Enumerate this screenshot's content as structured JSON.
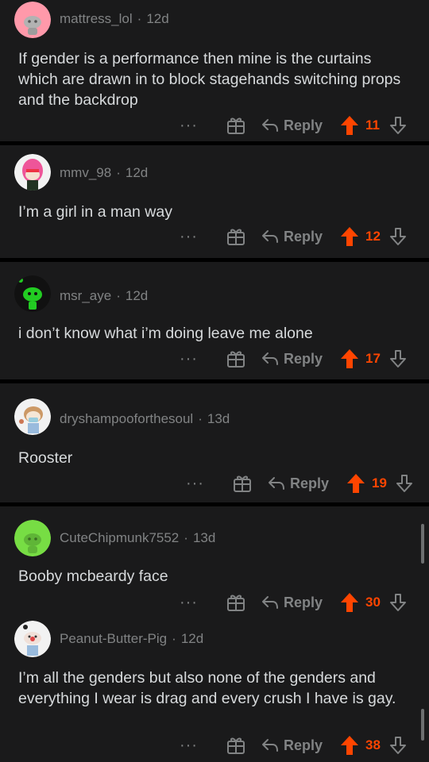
{
  "colors": {
    "background": "#000000",
    "card": "#1a1a1b",
    "accent": "#ff4500",
    "muted": "#818384",
    "text": "#d7dadc"
  },
  "comments": [
    {
      "username": "mattress_lol",
      "age": "12d",
      "body": "If gender is a performance then mine is the curtains which are drawn in to block stagehands switching props and the backdrop",
      "reply_label": "Reply",
      "score": "11",
      "more": "···",
      "avatar": "pink-snoo-avatar"
    },
    {
      "username": "mmv_98",
      "age": "12d",
      "body": "I’m a girl in a man way",
      "reply_label": "Reply",
      "score": "12",
      "more": "···",
      "avatar": "pink-hair-avatar"
    },
    {
      "username": "msr_aye",
      "age": "12d",
      "body": "i don’t know what i’m doing leave me alone",
      "reply_label": "Reply",
      "score": "17",
      "more": "···",
      "avatar": "green-snoo-avatar"
    },
    {
      "username": "dryshampooforthesoul",
      "age": "13d",
      "body": "Rooster",
      "reply_label": "Reply",
      "score": "19",
      "more": "···",
      "avatar": "masked-snoo-avatar"
    },
    {
      "username": "CuteChipmunk7552",
      "age": "13d",
      "body": "Booby mcbeardy face",
      "reply_label": "Reply",
      "score": "30",
      "more": "···",
      "avatar": "lime-snoo-avatar"
    },
    {
      "username": "Peanut-Butter-Pig",
      "age": "12d",
      "body": "I’m all the genders but also none of the genders and everything I wear is drag and every crush I have is gay.",
      "reply_label": "Reply",
      "score": "38",
      "more": "···",
      "avatar": "pig-snoo-avatar"
    }
  ]
}
